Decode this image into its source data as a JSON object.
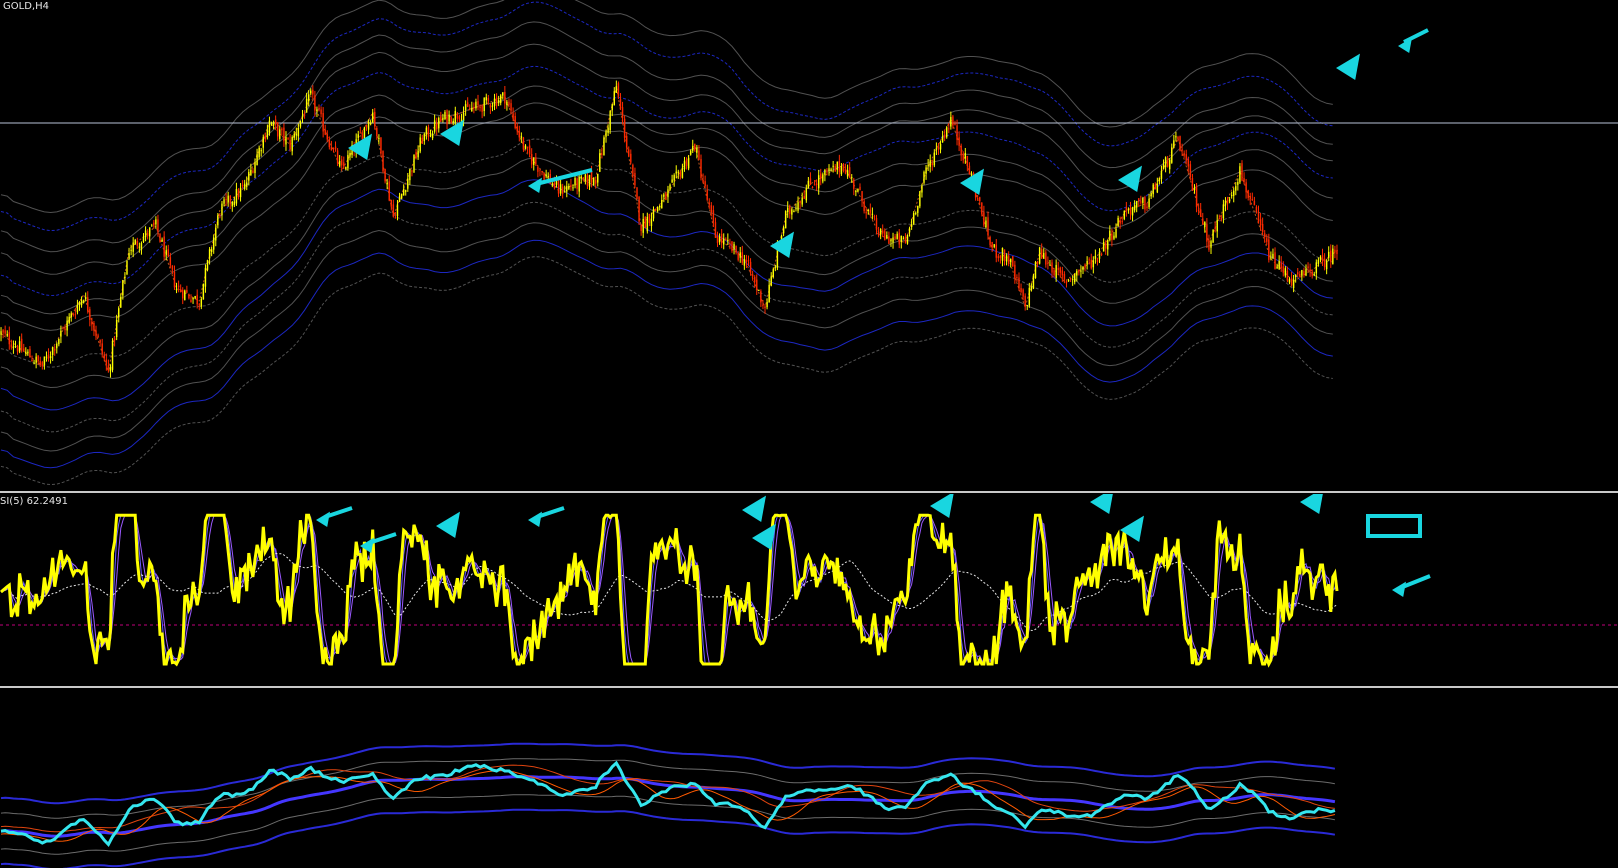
{
  "chart_data": [
    {
      "type": "candlestick",
      "pane": "price",
      "symbol_label": "GOLD,H4",
      "colors": {
        "bull": "#ffff00",
        "bear": "#ff2a00",
        "band_grey": "#5a5a5a",
        "band_blue": "#1f2bd6",
        "arrow": "#19d6e0",
        "hline": "#b9c2d6"
      },
      "anchors": [
        [
          0,
          0.22
        ],
        [
          20,
          0.12
        ],
        [
          40,
          0.34
        ],
        [
          52,
          0.1
        ],
        [
          62,
          0.48
        ],
        [
          75,
          0.55
        ],
        [
          85,
          0.36
        ],
        [
          96,
          0.32
        ],
        [
          106,
          0.6
        ],
        [
          118,
          0.67
        ],
        [
          130,
          0.87
        ],
        [
          140,
          0.8
        ],
        [
          150,
          0.95
        ],
        [
          165,
          0.72
        ],
        [
          180,
          0.9
        ],
        [
          190,
          0.58
        ],
        [
          204,
          0.82
        ],
        [
          214,
          0.88
        ],
        [
          232,
          0.92
        ],
        [
          244,
          0.95
        ],
        [
          254,
          0.78
        ],
        [
          270,
          0.66
        ],
        [
          288,
          0.7
        ],
        [
          298,
          0.98
        ],
        [
          310,
          0.55
        ],
        [
          322,
          0.64
        ],
        [
          336,
          0.8
        ],
        [
          346,
          0.52
        ],
        [
          360,
          0.45
        ],
        [
          370,
          0.3
        ],
        [
          380,
          0.58
        ],
        [
          392,
          0.68
        ],
        [
          408,
          0.74
        ],
        [
          426,
          0.52
        ],
        [
          438,
          0.5
        ],
        [
          448,
          0.72
        ],
        [
          460,
          0.88
        ],
        [
          470,
          0.7
        ],
        [
          480,
          0.48
        ],
        [
          488,
          0.45
        ],
        [
          496,
          0.3
        ],
        [
          503,
          0.47
        ],
        [
          515,
          0.38
        ],
        [
          530,
          0.45
        ],
        [
          545,
          0.6
        ],
        [
          555,
          0.62
        ],
        [
          570,
          0.82
        ],
        [
          585,
          0.5
        ],
        [
          600,
          0.72
        ],
        [
          615,
          0.45
        ],
        [
          626,
          0.38
        ],
        [
          636,
          0.42
        ],
        [
          648,
          0.48
        ]
      ],
      "num_candles": 648,
      "hline": 0.5
    },
    {
      "type": "line",
      "pane": "rsi",
      "label": "SI(5) 62.2491",
      "colors": {
        "rsi": "#ffff00",
        "signal": "#6a5cff",
        "signal2": "#9b59ff",
        "ma": "#e6e6e6",
        "level": "#c0007a",
        "arrow": "#19d6e0"
      },
      "level_label": "",
      "rsi_last": 62.2491
    },
    {
      "type": "line",
      "pane": "bottom",
      "colors": {
        "main": "#35e6ee",
        "orange1": "#ff5a00",
        "orange2": "#e0440f",
        "blue1": "#4436ff",
        "blue2": "#2a2ad6",
        "grey": "#6b6b6b"
      }
    }
  ]
}
